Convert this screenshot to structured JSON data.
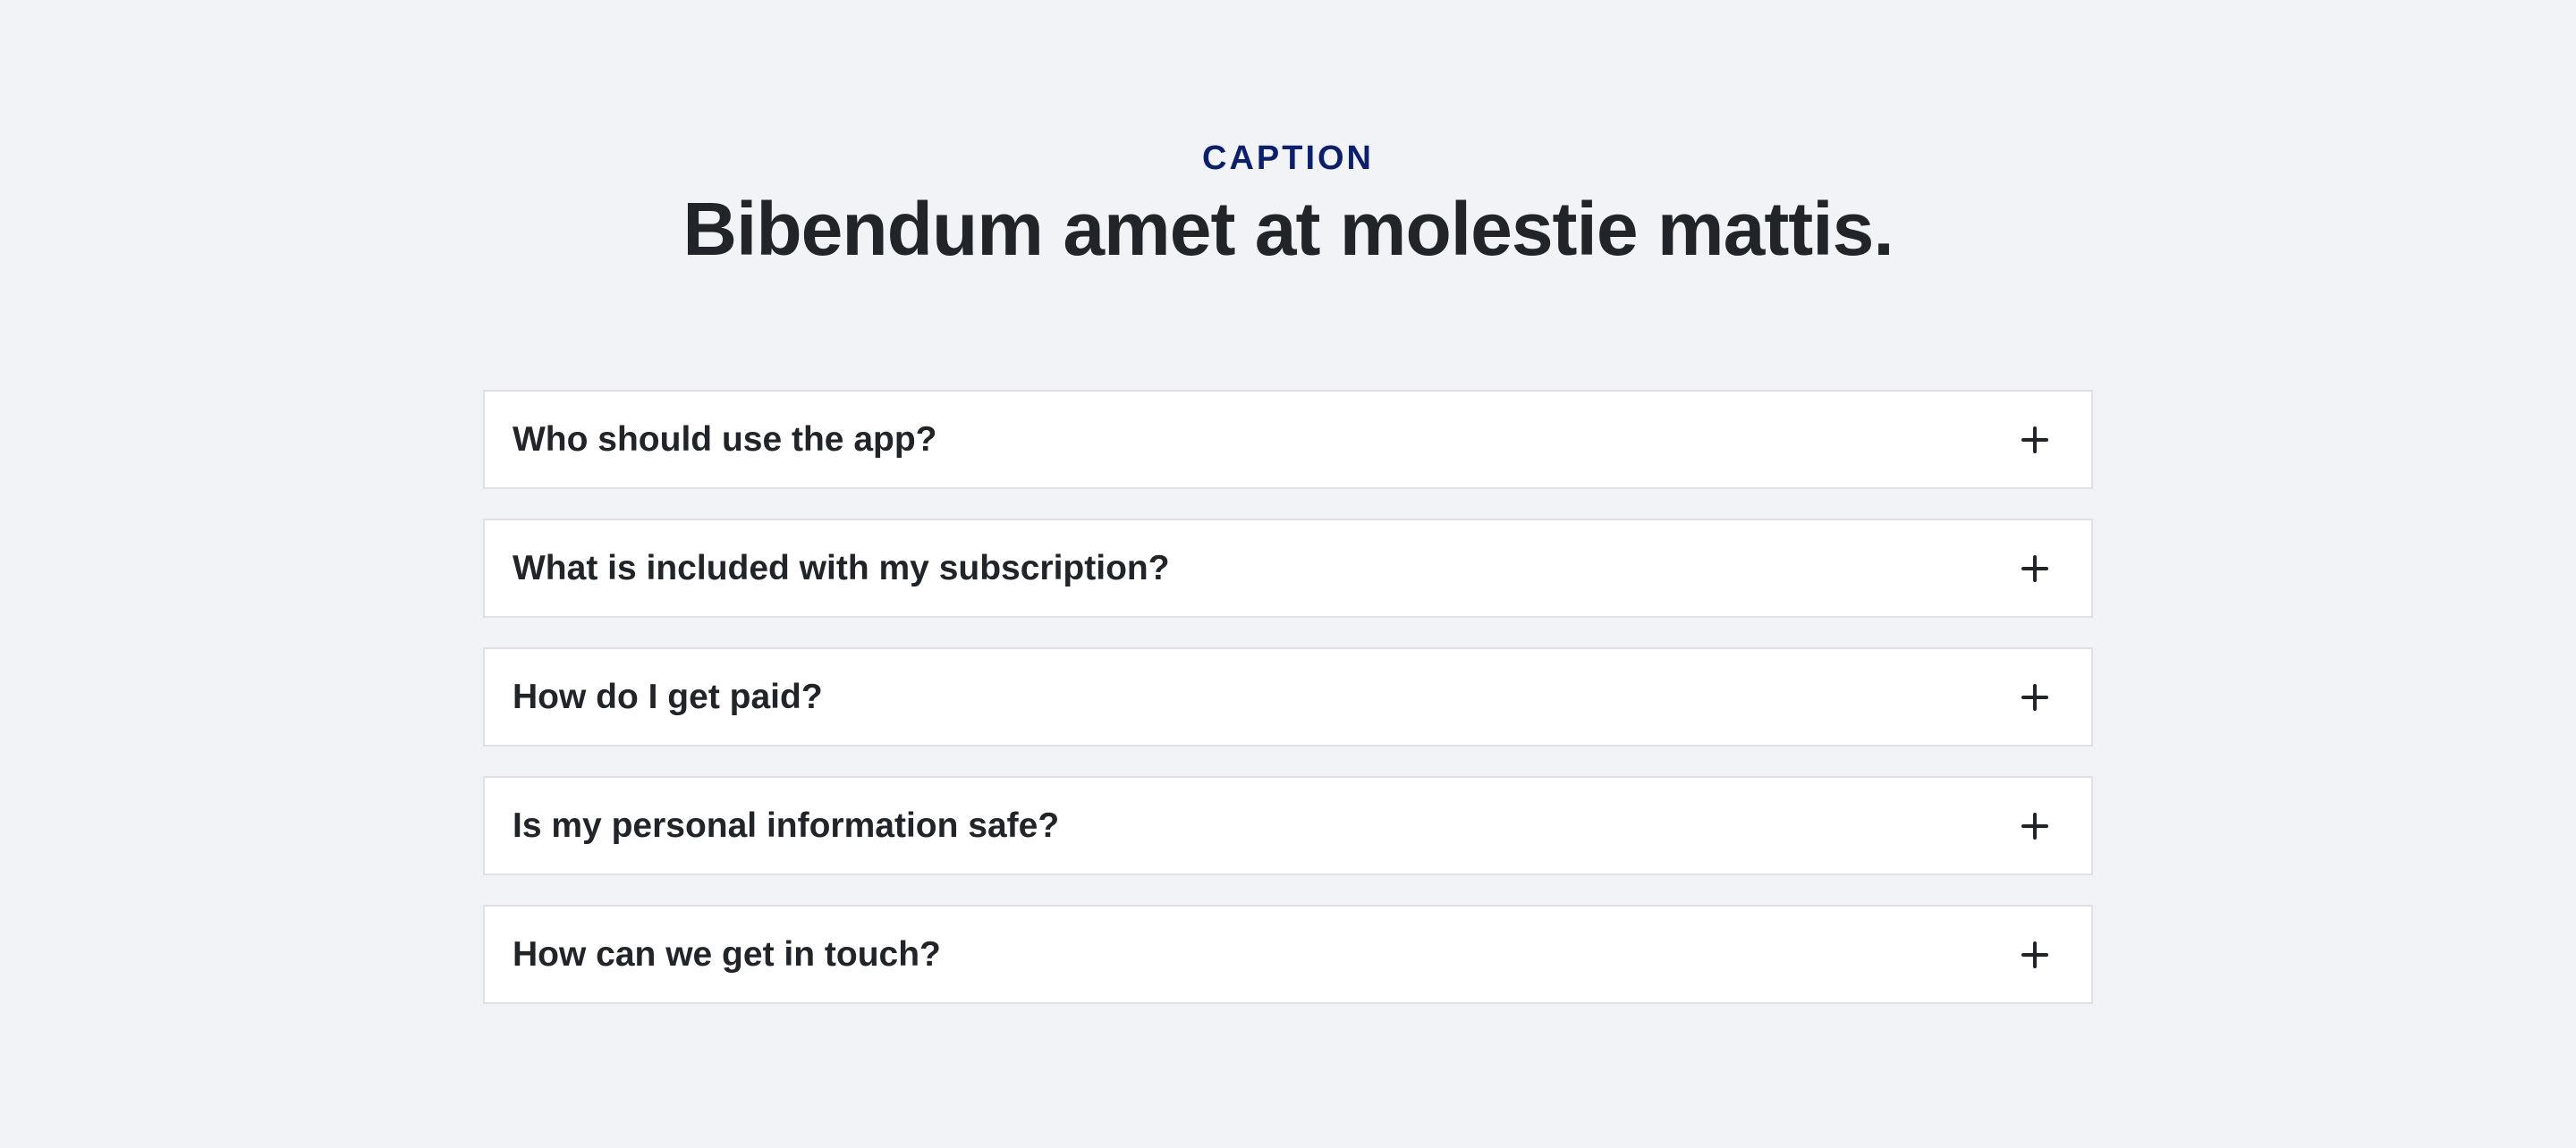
{
  "header": {
    "caption": "CAPTION",
    "title": "Bibendum amet at molestie mattis."
  },
  "faq": {
    "items": [
      {
        "question": "Who should use the app?",
        "icon": "plus-icon"
      },
      {
        "question": "What is included with my subscription?",
        "icon": "plus-icon"
      },
      {
        "question": "How do I get paid?",
        "icon": "plus-icon"
      },
      {
        "question": "Is my personal information safe?",
        "icon": "plus-icon"
      },
      {
        "question": "How can we get in touch?",
        "icon": "plus-icon"
      }
    ]
  },
  "colors": {
    "background": "#f2f3f7",
    "caption": "#0b1f6b",
    "text": "#212529",
    "border": "#dee2e6"
  }
}
